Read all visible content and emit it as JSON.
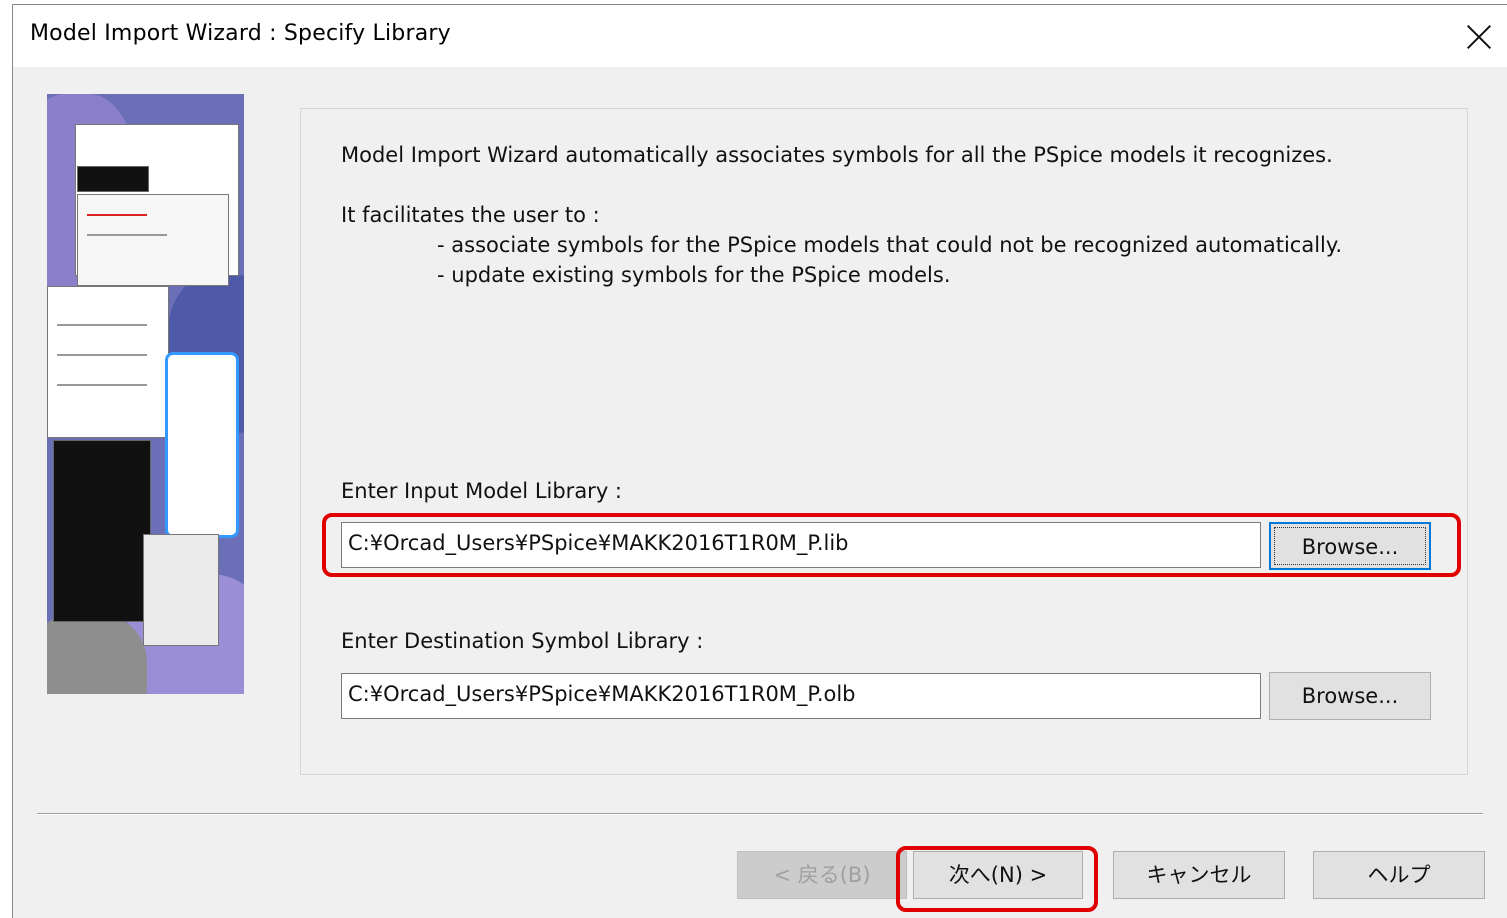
{
  "window": {
    "title": "Model Import Wizard : Specify Library"
  },
  "intro": {
    "line1": "Model Import Wizard automatically associates symbols for all the PSpice models it recognizes.",
    "line2": "It facilitates the user to :",
    "bullet1": "- associate symbols for the PSpice models that could not be recognized automatically.",
    "bullet2": "- update existing symbols for the PSpice models."
  },
  "input_library": {
    "label": "Enter Input Model Library :",
    "value": "C:¥Orcad_Users¥PSpice¥MAKK2016T1R0M_P.lib",
    "browse_label": "Browse..."
  },
  "destination_library": {
    "label": "Enter Destination Symbol Library :",
    "value": "C:¥Orcad_Users¥PSpice¥MAKK2016T1R0M_P.olb",
    "browse_label": "Browse..."
  },
  "footer": {
    "back_label": "< 戻る(B)",
    "next_label": "次へ(N) >",
    "cancel_label": "キャンセル",
    "help_label": "ヘルプ"
  },
  "colors": {
    "highlight": "#e00000",
    "focus": "#0078d7"
  }
}
